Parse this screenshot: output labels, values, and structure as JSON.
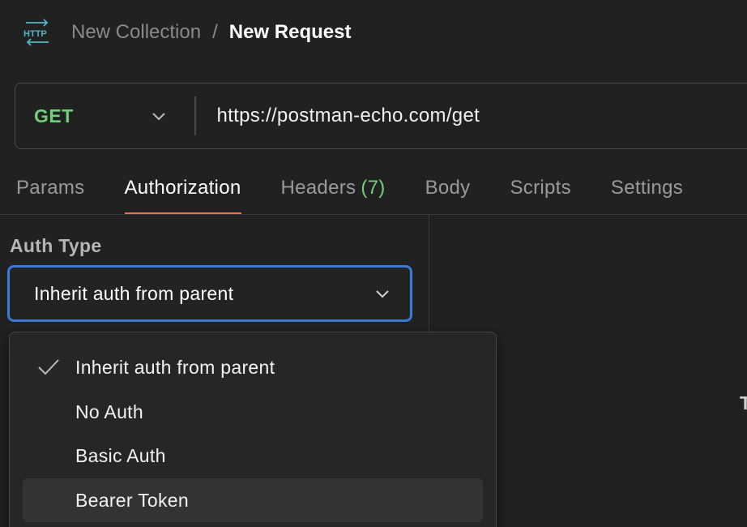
{
  "breadcrumb": {
    "icon": "http-icon",
    "collection": "New Collection",
    "separator": "/",
    "request": "New Request"
  },
  "request": {
    "method": "GET",
    "url": "https://postman-echo.com/get"
  },
  "tabs": [
    {
      "label": "Params",
      "active": false
    },
    {
      "label": "Authorization",
      "active": true
    },
    {
      "label": "Headers",
      "count": "(7)",
      "active": false
    },
    {
      "label": "Body",
      "active": false
    },
    {
      "label": "Scripts",
      "active": false
    },
    {
      "label": "Settings",
      "active": false
    }
  ],
  "auth": {
    "label": "Auth Type",
    "selected": "Inherit auth from parent",
    "options": [
      {
        "label": "Inherit auth from parent",
        "checked": true
      },
      {
        "label": "No Auth"
      },
      {
        "label": "Basic Auth"
      },
      {
        "label": "Bearer Token",
        "hovered": true
      }
    ]
  },
  "right_panel_fragment": "T",
  "colors": {
    "background": "#212121",
    "method_green": "#6fcf7a",
    "active_tab_underline": "#e8704a",
    "focus_border": "#3a7bd5",
    "icon_teal": "#4fb6c9"
  }
}
